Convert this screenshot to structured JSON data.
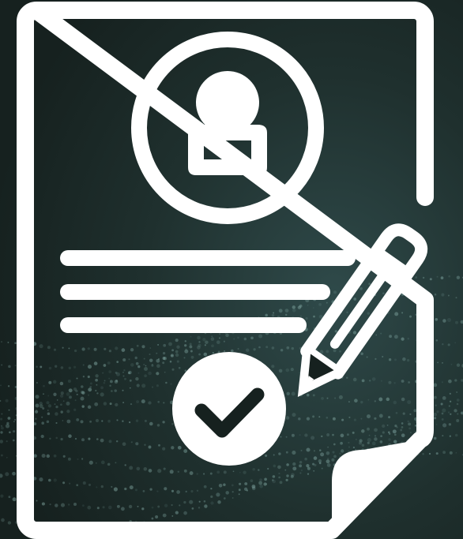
{
  "colors": {
    "background_dark": "#16211f",
    "background_teal": "#2f4a4a",
    "particle": "#7fa5a0",
    "icon": "#ffffff"
  },
  "icon": {
    "name": "contract-signing-icon",
    "parts": [
      "document-icon",
      "user-avatar-icon",
      "text-lines",
      "pencil-icon",
      "checkmark-badge-icon",
      "folded-corner"
    ]
  }
}
